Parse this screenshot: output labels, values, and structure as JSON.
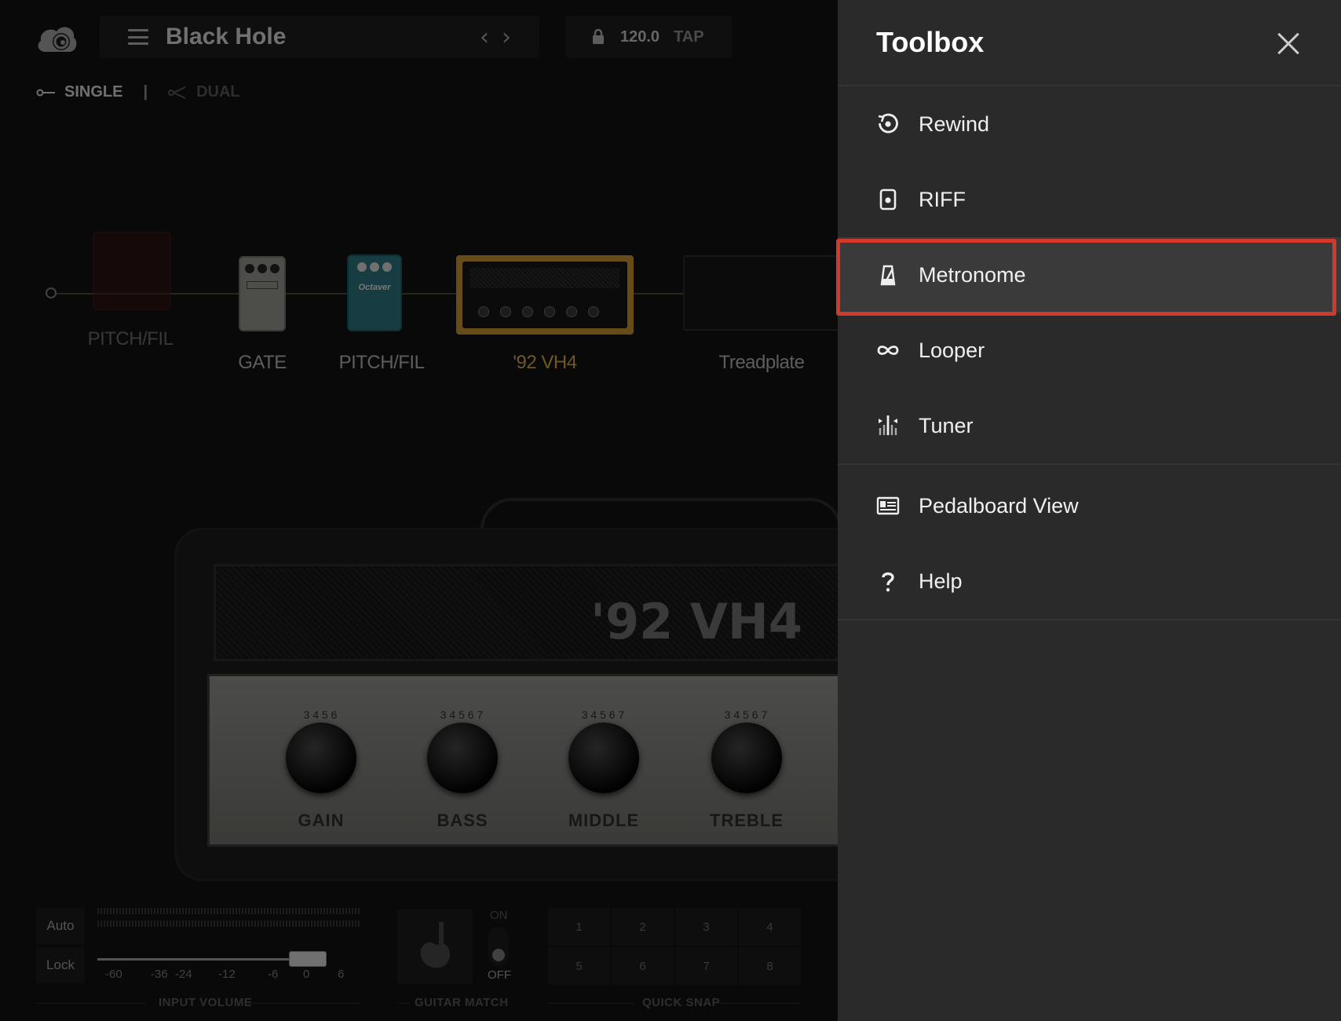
{
  "header": {
    "preset_name": "Black Hole",
    "bpm": "120.0",
    "tap_label": "TAP"
  },
  "mode": {
    "single_label": "SINGLE",
    "separator": "|",
    "dual_label": "DUAL"
  },
  "chain": {
    "items": [
      {
        "label": "PITCH/FIL"
      },
      {
        "label": "GATE"
      },
      {
        "label": "PITCH/FIL"
      },
      {
        "label": "'92 VH4"
      },
      {
        "label": "Treadplate"
      }
    ],
    "active_color": "#c9a04a"
  },
  "amp": {
    "title": "'92 VH4",
    "knobs": [
      {
        "label": "GAIN",
        "scale": "3 4 5 6"
      },
      {
        "label": "BASS",
        "scale": "3 4 5 6 7"
      },
      {
        "label": "MIDDLE",
        "scale": "3 4 5 6 7"
      },
      {
        "label": "TREBLE",
        "scale": "3 4 5 6 7"
      }
    ]
  },
  "input": {
    "auto_label": "Auto",
    "lock_label": "Lock",
    "scale": [
      "-60",
      "-36",
      "-24",
      "-12",
      "-6",
      "0",
      "6"
    ],
    "section_label": "INPUT VOLUME"
  },
  "guitar_match": {
    "on_label": "ON",
    "off_label": "OFF",
    "section_label": "GUITAR MATCH"
  },
  "quick_snap": {
    "slots": [
      "1",
      "2",
      "3",
      "4",
      "5",
      "6",
      "7",
      "8"
    ],
    "section_label": "QUICK SNAP"
  },
  "toolbox": {
    "title": "Toolbox",
    "groups": [
      [
        {
          "label": "Rewind",
          "icon": "rewind-icon"
        },
        {
          "label": "RIFF",
          "icon": "riff-icon"
        },
        {
          "label": "Metronome",
          "icon": "metronome-icon",
          "active": true
        },
        {
          "label": "Looper",
          "icon": "looper-icon"
        },
        {
          "label": "Tuner",
          "icon": "tuner-icon"
        }
      ],
      [
        {
          "label": "Pedalboard View",
          "icon": "pedalboard-icon"
        },
        {
          "label": "Help",
          "icon": "help-icon"
        }
      ]
    ],
    "highlight_color": "#d0392b"
  }
}
